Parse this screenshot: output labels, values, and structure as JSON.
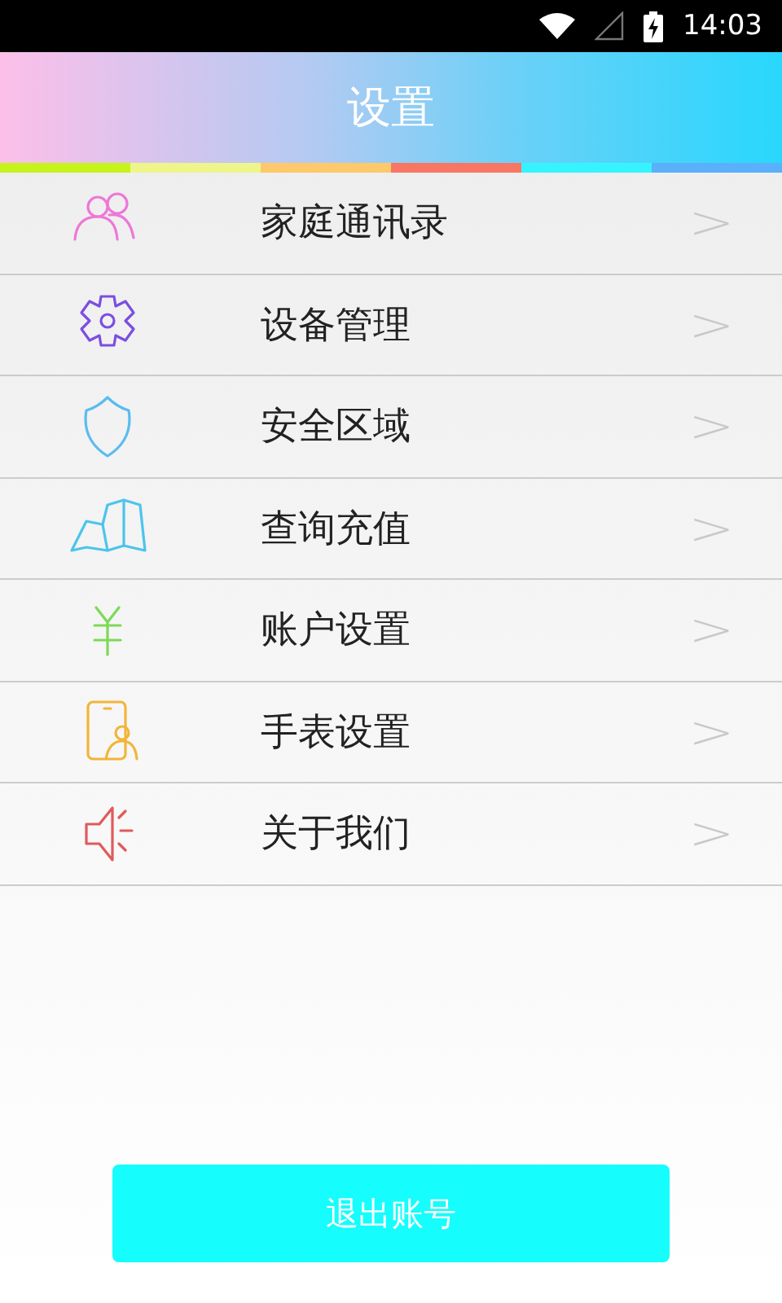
{
  "status_bar": {
    "time": "14:03"
  },
  "header": {
    "title": "设置"
  },
  "menu": [
    {
      "kind": "people",
      "color": "#ee77d8",
      "label": "家庭通讯录",
      "chevron": ">"
    },
    {
      "kind": "gear",
      "color": "#7b4fe0",
      "label": "设备管理",
      "chevron": ">"
    },
    {
      "kind": "shield",
      "color": "#5bbcf0",
      "label": "安全区域",
      "chevron": ">"
    },
    {
      "kind": "map",
      "color": "#4cc4ec",
      "label": "查询充值",
      "chevron": ">"
    },
    {
      "kind": "yen",
      "color": "#7ed957",
      "label": "账户设置",
      "chevron": ">"
    },
    {
      "kind": "phone",
      "color": "#f2b53a",
      "label": "手表设置",
      "chevron": ">"
    },
    {
      "kind": "speaker",
      "color": "#e05a5a",
      "label": "关于我们",
      "chevron": ">"
    }
  ],
  "logout_button": "退出账号"
}
